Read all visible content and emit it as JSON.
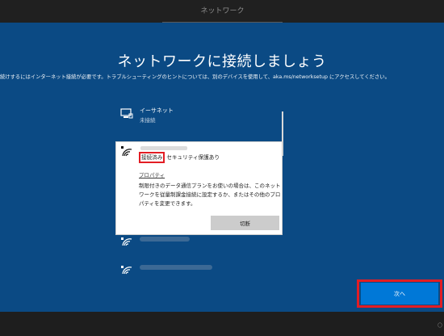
{
  "header": {
    "tab_label": "ネットワーク"
  },
  "main": {
    "title": "ネットワークに接続しましょう",
    "description": "続けするにはインターネット接続が必要です。トラブルシューティングのヒントについては、別のデバイスを使用して、aka.ms/networksetup にアクセスしてください。"
  },
  "networks": [
    {
      "name": "イーサネット",
      "status": "未接続",
      "icon": "ethernet-icon"
    },
    {
      "name": "",
      "status": "",
      "icon": "wifi-secured-icon"
    },
    {
      "name": "",
      "status": "",
      "icon": "wifi-secured-icon"
    },
    {
      "name": "",
      "status": "",
      "icon": "wifi-secured-icon"
    }
  ],
  "selected_network": {
    "status_connected": "接続済み",
    "status_security": "セキュリティ保護あり",
    "properties_link": "プロパティ",
    "description": "制限付きのデータ通信プランをお使いの場合は、このネットワークを従量制課金接続に設定するか、またはその他のプロパティを変更できます。",
    "disconnect_label": "切断"
  },
  "footer": {
    "next_label": "次へ",
    "corner_glyph": "〇"
  },
  "colors": {
    "background": "#0b4a84",
    "accent": "#0078d7",
    "highlight": "#e21d24"
  }
}
